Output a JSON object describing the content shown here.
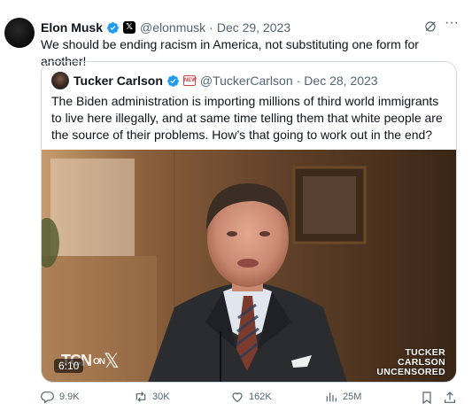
{
  "tweet": {
    "author_name": "Elon Musk",
    "handle": "@elonmusk",
    "date": "Dec 29, 2023",
    "separator": "·",
    "text": "We should be ending racism in America, not substituting one form for another!",
    "more_glyph": "···"
  },
  "quote": {
    "author_name": "Tucker Carlson",
    "handle": "@TuckerCarlson",
    "date": "Dec 28, 2023",
    "separator": "·",
    "org_badge_text": "NEW",
    "text": "The Biden administration is importing millions of third world immigrants to live here illegally, and at same time telling them that white people are the source of their problems. How’s that going to work out in the end?",
    "video": {
      "duration": "6:10",
      "brand_logo": "TCN",
      "brand_on": "ON",
      "brand_x": "𝕏",
      "show_title_line1": "TUCKER",
      "show_title_line2": "CARLSON",
      "show_title_line3": "UNCENSORED"
    }
  },
  "actions": {
    "replies": "9.9K",
    "reposts": "30K",
    "likes": "162K",
    "views": "25M"
  },
  "colors": {
    "text_primary": "#0f1419",
    "text_secondary": "#536471",
    "verified_blue": "#1d9bf0",
    "border": "#cfd9de"
  },
  "icons": [
    "verified-badge-icon",
    "x-affiliate-icon",
    "grok-icon",
    "more-icon",
    "reply-icon",
    "repost-icon",
    "like-icon",
    "views-icon",
    "bookmark-icon",
    "share-icon"
  ]
}
